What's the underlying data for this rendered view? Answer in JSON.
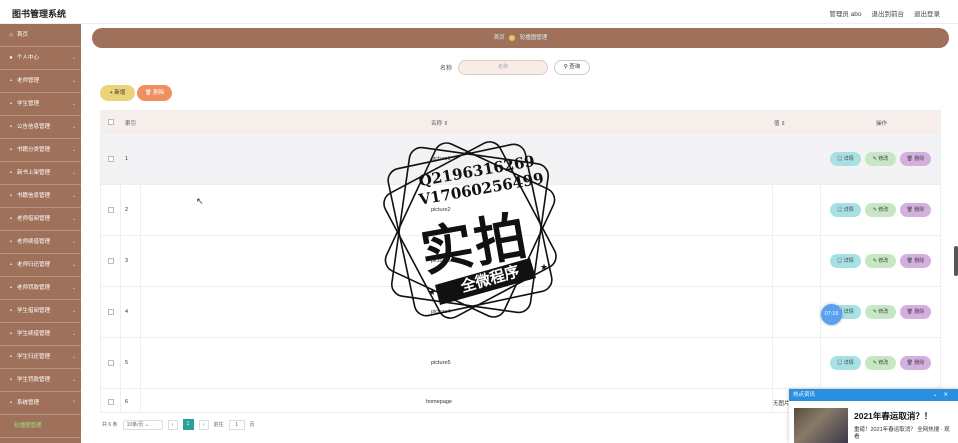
{
  "app": {
    "title": "图书管理系统"
  },
  "header": {
    "user": "管理员 abo",
    "to_front": "退出到前台",
    "logout": "退出登录"
  },
  "sidebar": {
    "items": [
      {
        "label": "首页",
        "icon": "home-icon"
      },
      {
        "label": "个人中心",
        "icon": "person-icon"
      },
      {
        "label": "老师管理",
        "icon": "user-icon"
      },
      {
        "label": "学生管理",
        "icon": "user-icon"
      },
      {
        "label": "公告信息管理",
        "icon": "notice-icon"
      },
      {
        "label": "书籍分类管理",
        "icon": "category-icon"
      },
      {
        "label": "新书上架管理",
        "icon": "book-icon"
      },
      {
        "label": "书籍信息管理",
        "icon": "book-icon"
      },
      {
        "label": "老师借阅管理",
        "icon": "borrow-icon"
      },
      {
        "label": "老师续借管理",
        "icon": "renew-icon"
      },
      {
        "label": "老师归还管理",
        "icon": "return-icon"
      },
      {
        "label": "老师罚款管理",
        "icon": "fine-icon"
      },
      {
        "label": "学生借阅管理",
        "icon": "borrow-icon"
      },
      {
        "label": "学生续借管理",
        "icon": "renew-icon"
      },
      {
        "label": "学生归还管理",
        "icon": "return-icon"
      },
      {
        "label": "学生罚款管理",
        "icon": "fine-icon"
      },
      {
        "label": "系统管理",
        "icon": "settings-icon"
      },
      {
        "label": "轮播图管理",
        "icon": ""
      }
    ]
  },
  "breadcrumb": {
    "home": "首页",
    "current": "轮播图管理"
  },
  "search": {
    "label": "名称",
    "placeholder": "名称",
    "button": "查询"
  },
  "toolbar": {
    "add": "新增",
    "delete": "删除"
  },
  "table": {
    "headers": {
      "index": "索引",
      "name": "名称",
      "value": "值",
      "ops": "操作"
    },
    "rows": [
      {
        "index": "1",
        "name": "picture1",
        "value": ""
      },
      {
        "index": "2",
        "name": "picture2",
        "value": ""
      },
      {
        "index": "3",
        "name": "picture3",
        "value": ""
      },
      {
        "index": "4",
        "name": "picture4",
        "value": ""
      },
      {
        "index": "5",
        "name": "picture5",
        "value": ""
      },
      {
        "index": "6",
        "name": "homepage",
        "value": "无图片"
      }
    ],
    "ops": {
      "detail": "详情",
      "edit": "修改",
      "delete": "删除"
    }
  },
  "pager": {
    "total": "共 6 条",
    "size": "10条/页",
    "page": "1",
    "goto": "前往",
    "goto_value": "1",
    "unit": "页"
  },
  "overlay": {
    "stamp_line1": "Q2196316269",
    "stamp_line2": "V17060256499",
    "stamp_big": "实拍",
    "stamp_small": "全微程序",
    "timer": "07:19"
  },
  "news": {
    "header": "热点资讯",
    "headline": "2021年春运取消？！",
    "summary": "重磅！2021年春运取消？ 全网热搜 · 观看"
  }
}
